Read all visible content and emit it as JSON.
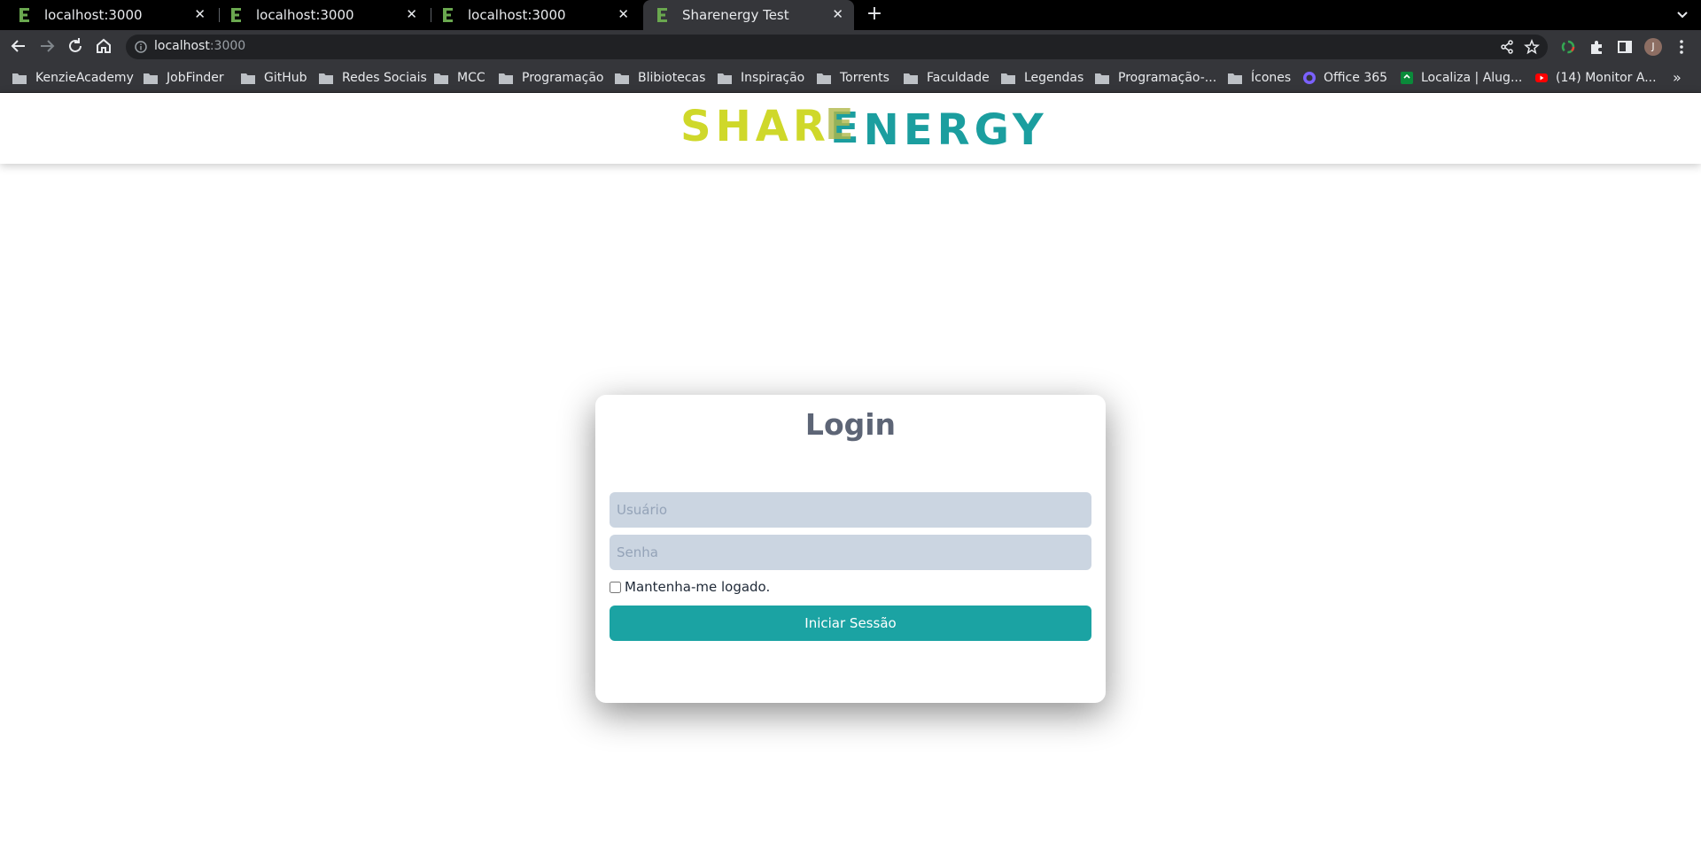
{
  "browser": {
    "tabs": [
      {
        "title": "localhost:3000",
        "active": false
      },
      {
        "title": "localhost:3000",
        "active": false
      },
      {
        "title": "localhost:3000",
        "active": false
      },
      {
        "title": "Sharenergy Test",
        "active": true
      }
    ],
    "address": {
      "host": "localhost",
      "port": ":3000"
    },
    "bookmarks": [
      {
        "label": "KenzieAcademy",
        "icon": "folder-icon"
      },
      {
        "label": "JobFinder",
        "icon": "folder-icon"
      },
      {
        "label": "GitHub",
        "icon": "folder-icon"
      },
      {
        "label": "Redes Sociais",
        "icon": "folder-icon"
      },
      {
        "label": "MCC",
        "icon": "folder-icon"
      },
      {
        "label": "Programação",
        "icon": "folder-icon"
      },
      {
        "label": "Blibiotecas",
        "icon": "folder-icon"
      },
      {
        "label": "Inspiração",
        "icon": "folder-icon"
      },
      {
        "label": "Torrents",
        "icon": "folder-icon"
      },
      {
        "label": "Faculdade",
        "icon": "folder-icon"
      },
      {
        "label": "Legendas",
        "icon": "folder-icon"
      },
      {
        "label": "Programação-...",
        "icon": "folder-icon"
      },
      {
        "label": "Ícones",
        "icon": "folder-icon"
      },
      {
        "label": "Office 365",
        "icon": "office-icon"
      },
      {
        "label": "Localiza | Alug...",
        "icon": "localiza-icon"
      },
      {
        "label": "(14) Monitor A...",
        "icon": "youtube-icon"
      }
    ],
    "profile_initial": "J"
  },
  "header": {
    "logo_part1": "SHAR",
    "logo_mid": "E",
    "logo_part2": "NERGY",
    "colors": {
      "yellow": "#cfd82a",
      "teal": "#1b9e9f"
    }
  },
  "login": {
    "title": "Login",
    "username_placeholder": "Usuário",
    "password_placeholder": "Senha",
    "remember_label": "Mantenha-me logado.",
    "submit_label": "Iniciar Sessão",
    "colors": {
      "button": "#1ba3a3",
      "field": "#cbd5e1",
      "title": "#5d6576"
    }
  }
}
